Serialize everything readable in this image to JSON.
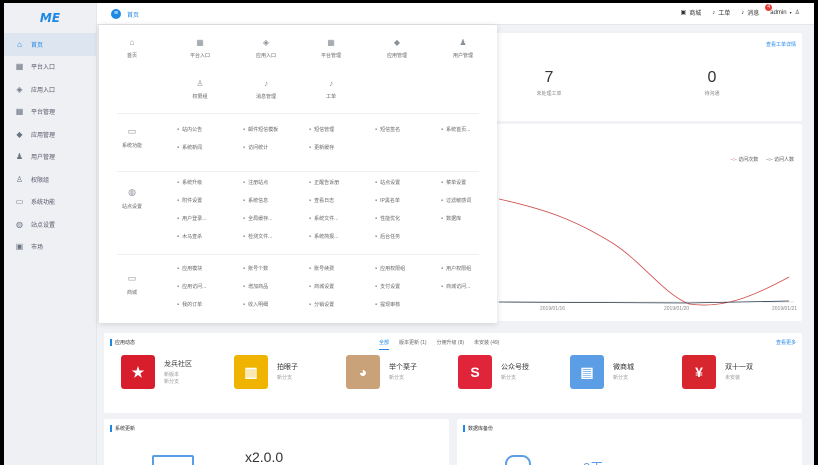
{
  "logo": "ME",
  "sidebar": {
    "items": [
      {
        "label": "首页",
        "icon": "home-icon",
        "glyph": "⌂"
      },
      {
        "label": "平台入口",
        "icon": "grid-icon",
        "glyph": "▦"
      },
      {
        "label": "应用入口",
        "icon": "cube-icon",
        "glyph": "◈"
      },
      {
        "label": "平台管理",
        "icon": "apps-icon",
        "glyph": "▦"
      },
      {
        "label": "应用管理",
        "icon": "cubes-icon",
        "glyph": "◆"
      },
      {
        "label": "用户管理",
        "icon": "users-icon",
        "glyph": "♟"
      },
      {
        "label": "权限组",
        "icon": "user-group-icon",
        "glyph": "♙"
      },
      {
        "label": "系统功能",
        "icon": "monitor-icon",
        "glyph": "▭"
      },
      {
        "label": "站点设置",
        "icon": "globe-icon",
        "glyph": "◍"
      },
      {
        "label": "市场",
        "icon": "store-icon",
        "glyph": "▣"
      }
    ]
  },
  "topbar": {
    "breadcrumb": "首页",
    "mall": "商城",
    "worksheet": "工单",
    "messages": "消息",
    "message_count": "4",
    "user": "admin"
  },
  "shortcuts": [
    {
      "label": "首页",
      "glyph": "⌂"
    },
    {
      "label": "平台入口",
      "glyph": "▦"
    },
    {
      "label": "应用入口",
      "glyph": "◈"
    },
    {
      "label": "平台管理",
      "glyph": "▦"
    },
    {
      "label": "应用管理",
      "glyph": "◆"
    },
    {
      "label": "用户管理",
      "glyph": "♟"
    },
    {
      "label": "权限组",
      "glyph": "♙"
    },
    {
      "label": "消息管理",
      "glyph": "♪"
    },
    {
      "label": "工单",
      "glyph": "♪"
    }
  ],
  "sections": [
    {
      "label": "系统功能",
      "glyph": "▭",
      "rows": [
        [
          "站内公告",
          "邮件短信模板",
          "短信管理",
          "短信签名",
          "系统首页..."
        ],
        [
          "系统新闻",
          "访问统计",
          "更新缓存"
        ]
      ]
    },
    {
      "label": "站点设置",
      "glyph": "◍",
      "rows": [
        [
          "系统升级",
          "注册站点",
          "正醒告诉册",
          "站点设置",
          "菜单设置"
        ],
        [
          "附件设置",
          "系统信息",
          "查看日志",
          "IP黑名单",
          "过滤敏感词"
        ],
        [
          "用户登录...",
          "全局缓存...",
          "系统文件...",
          "性能优化",
          "数据库"
        ],
        [
          "木马查杀",
          "检测文件...",
          "系统简报...",
          "后台任务"
        ]
      ]
    },
    {
      "label": "商城",
      "glyph": "▭",
      "rows": [
        [
          "应用模块",
          "账号个数",
          "账号续费",
          "应用权限组",
          "用户权限组"
        ],
        [
          "应用访问...",
          "增加商品",
          "商城设置",
          "支付设置",
          "商城访问..."
        ],
        [
          "我的订单",
          "收入明细",
          "分销设置",
          "提现审核"
        ]
      ]
    }
  ],
  "worksheet_link": "查看工单详情",
  "stats": [
    {
      "value": "7",
      "label": "未处理工单"
    },
    {
      "value": "0",
      "label": "待沟通"
    }
  ],
  "chart_data": {
    "type": "line",
    "legend": [
      "访问次数",
      "访问人数"
    ],
    "x_ticks": [
      "2019/01/16",
      "2019/01/20",
      "2019/01/21"
    ],
    "series_colors": [
      "#d04a4a",
      "#2c3e50"
    ]
  },
  "apps": {
    "title": "应用动态",
    "more": "查看更多",
    "tabs": [
      "全部",
      "版本更新 (1)",
      "分佣升级 (8)",
      "未安装 (49)"
    ],
    "items": [
      {
        "name": "龙兵社区",
        "sub1": "新版本",
        "sub2": "新分支",
        "color": "#d81e2c",
        "glyph": "★"
      },
      {
        "name": "拍眼子",
        "sub1": "新分支",
        "sub2": "",
        "color": "#f0b400",
        "glyph": "▥"
      },
      {
        "name": "举个栗子",
        "sub1": "新分支",
        "sub2": "",
        "color": "#c9a27a",
        "glyph": "◕"
      },
      {
        "name": "公众号授",
        "sub1": "新分支",
        "sub2": "",
        "color": "#e0243a",
        "glyph": "S"
      },
      {
        "name": "微商城",
        "sub1": "新分支",
        "sub2": "",
        "color": "#5b9ee6",
        "glyph": "▤"
      },
      {
        "name": "双十一双",
        "sub1": "未安装",
        "sub2": "",
        "color": "#d8262e",
        "glyph": "¥"
      }
    ]
  },
  "system_update": {
    "title": "系统更新",
    "version": "x2.0.0"
  },
  "db_backup": {
    "title": "数据库备份",
    "value": "0天"
  }
}
